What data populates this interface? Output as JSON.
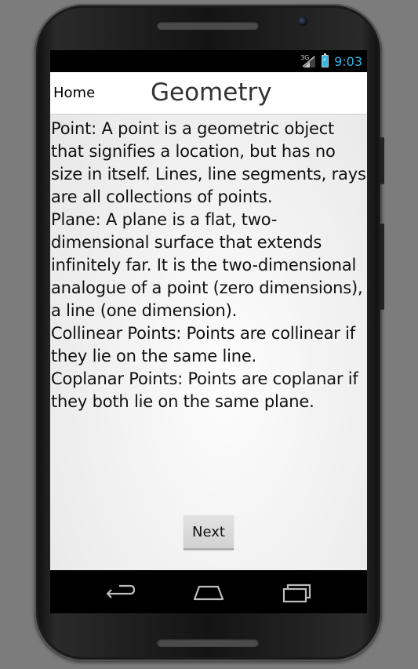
{
  "status_bar": {
    "network": "3G",
    "time": "9:03"
  },
  "action_bar": {
    "home_label": "Home",
    "title": "Geometry"
  },
  "content": {
    "paragraphs": [
      "Point: A point is a geometric object that signifies a location, but has no size in itself. Lines, line segments, rays are all collections of points.",
      "Plane: A plane is a flat, two-dimensional surface that extends infinitely far. It is the two-dimensional analogue of a point (zero dimensions), a line (one dimension).",
      "Collinear Points: Points are collinear if they lie on the same line.",
      "Coplanar Points: Points are coplanar if they both lie on the same plane."
    ]
  },
  "next_label": "Next",
  "nav_bar": {
    "icons": [
      "back-icon",
      "home-icon",
      "recents-icon"
    ]
  },
  "colors": {
    "accent": "#33b5e5",
    "app_background": "#f2f2f2",
    "action_bar": "#ffffff",
    "button": "#d8d8d8"
  }
}
